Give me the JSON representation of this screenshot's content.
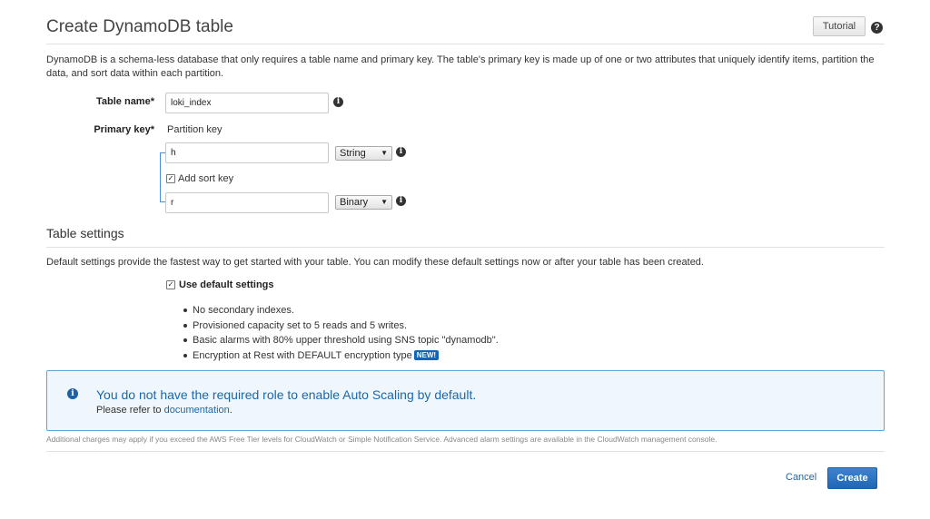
{
  "header": {
    "title": "Create DynamoDB table",
    "tutorial_label": "Tutorial",
    "help_glyph": "?"
  },
  "description": "DynamoDB is a schema-less database that only requires a table name and primary key. The table's primary key is made up of one or two attributes that uniquely identify items, partition the data, and sort data within each partition.",
  "form": {
    "table_name_label": "Table name*",
    "table_name_value": "loki_index",
    "primary_key_label": "Primary key*",
    "partition_key_label": "Partition key",
    "partition_key_value": "h",
    "partition_key_type": "String",
    "add_sort_key_label": "Add sort key",
    "add_sort_key_checked": true,
    "sort_key_value": "r",
    "sort_key_type": "Binary"
  },
  "table_settings": {
    "title": "Table settings",
    "description": "Default settings provide the fastest way to get started with your table. You can modify these default settings now or after your table has been created.",
    "use_default_label": "Use default settings",
    "use_default_checked": true,
    "bullets": [
      "No secondary indexes.",
      "Provisioned capacity set to 5 reads and 5 writes.",
      "Basic alarms with 80% upper threshold using SNS topic \"dynamodb\".",
      "Encryption at Rest with DEFAULT encryption type"
    ],
    "new_badge": "NEW!"
  },
  "alert": {
    "title": "You do not have the required role to enable Auto Scaling by default.",
    "body_prefix": "Please refer to",
    "link_text": "documentation",
    "body_suffix": "."
  },
  "footnote": "Additional charges may apply if you exceed the AWS Free Tier levels for CloudWatch or Simple Notification Service. Advanced alarm settings are available in the CloudWatch management console.",
  "actions": {
    "cancel_label": "Cancel",
    "create_label": "Create"
  },
  "colors": {
    "accent": "#1e66a8",
    "primary_button": "#1f67b5",
    "alert_border": "#5aa6d6",
    "alert_background": "#eff7fd",
    "bracket": "#4a90d9"
  }
}
